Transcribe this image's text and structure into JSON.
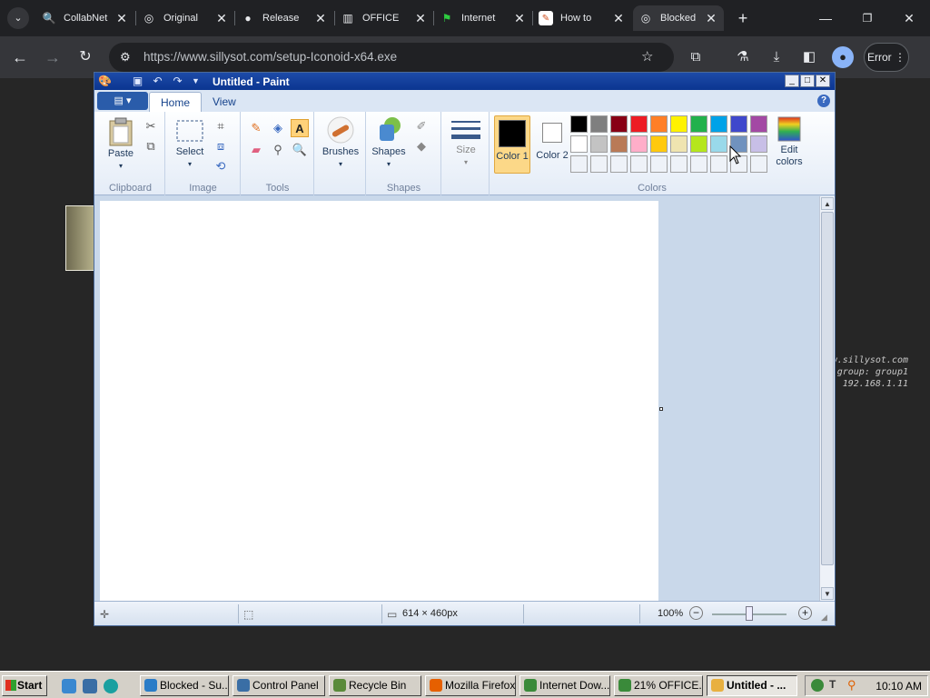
{
  "browser": {
    "tabs": [
      {
        "title": "CollabNet",
        "icon": "search-icon"
      },
      {
        "title": "Original",
        "icon": "globe-icon"
      },
      {
        "title": "Release",
        "icon": "github-icon"
      },
      {
        "title": "OFFICE",
        "icon": "building-icon"
      },
      {
        "title": "Internet",
        "icon": "flag-icon"
      },
      {
        "title": "How to",
        "icon": "paint-icon"
      },
      {
        "title": "Blocked",
        "icon": "globe-icon",
        "active": true
      }
    ],
    "url": "https://www.sillysot.com/setup-Iconoid-x64.exe",
    "error_label": "Error"
  },
  "overlay": {
    "lines": [
      "www.sillysot.com",
      "group: group1",
      "192.168.1.11"
    ]
  },
  "paint": {
    "title": "Untitled - Paint",
    "tabs": {
      "home": "Home",
      "view": "View"
    },
    "groups": {
      "clipboard": "Clipboard",
      "image": "Image",
      "tools": "Tools",
      "shapes": "Shapes",
      "colors": "Colors"
    },
    "buttons": {
      "paste": "Paste",
      "select": "Select",
      "brushes": "Brushes",
      "shapes": "Shapes",
      "size": "Size",
      "color1": "Color 1",
      "color2": "Color 2",
      "edit_colors": "Edit colors"
    },
    "palette_row1": [
      "#000000",
      "#7f7f7f",
      "#880015",
      "#ed1c24",
      "#ff7f27",
      "#fff200",
      "#22b14c",
      "#00a2e8",
      "#3f48cc",
      "#a349a4"
    ],
    "palette_row2": [
      "#ffffff",
      "#c3c3c3",
      "#b97a57",
      "#ffaec9",
      "#ffc90e",
      "#efe4b0",
      "#b5e61d",
      "#99d9ea",
      "#7092be",
      "#c8bfe7"
    ],
    "color1": "#000000",
    "color2": "#ffffff",
    "status": {
      "dimensions": "614 × 460px",
      "zoom": "100%"
    }
  },
  "taskbar": {
    "start": "Start",
    "items": [
      {
        "label": "Blocked - Su...",
        "color": "#2a7cc7"
      },
      {
        "label": "Control Panel",
        "color": "#3a6ea5"
      },
      {
        "label": "Recycle Bin",
        "color": "#5a8a3a"
      },
      {
        "label": "Mozilla Firefox",
        "color": "#e66000"
      },
      {
        "label": "Internet Dow...",
        "color": "#3a8a3a"
      },
      {
        "label": "21% OFFICE...",
        "color": "#3a8a3a"
      },
      {
        "label": "Untitled - ...",
        "color": "#e8b040",
        "active": true
      }
    ],
    "time": "10:10 AM"
  }
}
